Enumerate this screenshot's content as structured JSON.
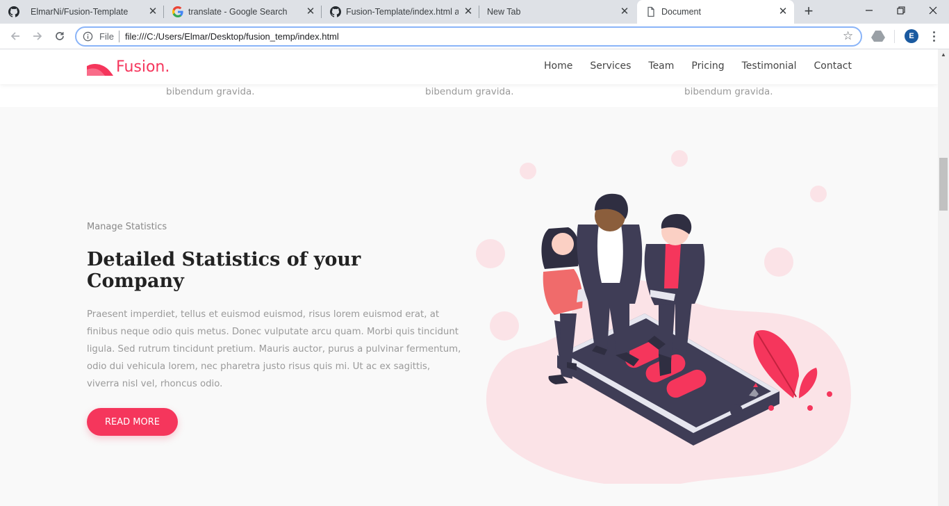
{
  "browser": {
    "tabs": [
      {
        "title": "ElmarNi/Fusion-Template",
        "icon": "github-icon",
        "active": false
      },
      {
        "title": "translate - Google Search",
        "icon": "google-icon",
        "active": false
      },
      {
        "title": "Fusion-Template/index.html at",
        "icon": "github-icon",
        "active": false
      },
      {
        "title": "New Tab",
        "icon": "",
        "active": false
      },
      {
        "title": "Document",
        "icon": "document-icon",
        "active": true
      }
    ],
    "address": {
      "scheme": "File",
      "url": "file:///C:/Users/Elmar/Desktop/fusion_temp/index.html"
    },
    "profile_initial": "E"
  },
  "site": {
    "brand": "Fusion.",
    "nav": [
      "Home",
      "Services",
      "Team",
      "Pricing",
      "Testimonial",
      "Contact"
    ],
    "previous_section_tail": [
      "bibendum gravida.",
      "bibendum gravida.",
      "bibendum gravida."
    ],
    "stats": {
      "eyebrow": "Manage Statistics",
      "heading": "Detailed Statistics of your Company",
      "body": "Praesent imperdiet, tellus et euismod euismod, risus lorem euismod erat, at finibus neque odio quis metus. Donec vulputate arcu quam. Morbi quis tincidunt ligula. Sed rutrum tincidunt pretium. Mauris auctor, purus a pulvinar fermentum, odio dui vehicula lorem, nec pharetra justo risus quis mi. Ut ac ex sagittis, viverra nisl vel, rhoncus odio.",
      "button": "READ MORE"
    }
  },
  "colors": {
    "accent": "#f5365c",
    "accent_light": "#fbe3e7",
    "figure_dark": "#3f3d56"
  }
}
